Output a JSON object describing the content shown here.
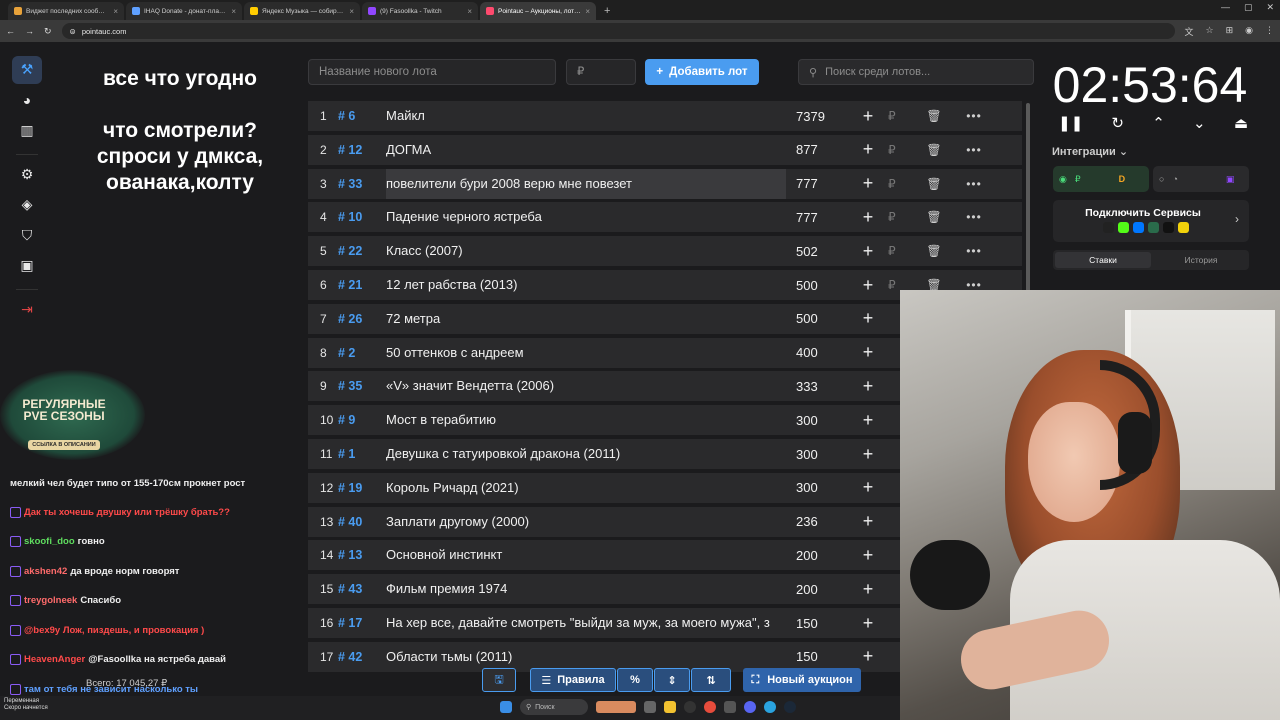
{
  "browser": {
    "tabs": [
      {
        "title": "Виджет последних сообщений",
        "color": "#e8a23a",
        "active": false
      },
      {
        "title": "IHAQ Donate - донат-платформа",
        "color": "#5fa0ff",
        "active": false
      },
      {
        "title": "Яндекс Музыка — собираем",
        "color": "#ffcc00",
        "active": false
      },
      {
        "title": "(9) Fasoollka - Twitch",
        "color": "#9147ff",
        "active": false
      },
      {
        "title": "Pointauc – Аукционы, лотереи",
        "color": "#ff4a6e",
        "active": true
      }
    ],
    "url": "pointauc.com"
  },
  "overlay": {
    "line1": "все что угодно",
    "line2": "что смотрели?",
    "line3": "спроси у дмкса,",
    "line4": "ованака,колту",
    "badge_line1": "РЕГУЛЯРНЫЕ",
    "badge_line2": "PVE СЕЗОНЫ",
    "badge_line3": "ССЫЛКА В ОПИСАНИИ"
  },
  "chat": [
    {
      "name": "",
      "message": "мелкий чел будет типо от 155-170см прокнет рост",
      "color": "#efefef"
    },
    {
      "name": "",
      "message": "Дак ты хочешь двушку или трёшку брать??",
      "color": "#ff4a4a"
    },
    {
      "name": "skoofi_doo",
      "message": "говно",
      "color": "#5fdd5f"
    },
    {
      "name": "akshen42",
      "message": "да вроде норм говорят",
      "color": "#ff6b6b"
    },
    {
      "name": "treygolneek",
      "message": "Спасибо",
      "color": "#ff6b6b"
    },
    {
      "name": "",
      "message": "@bex9y Лож, пиздешь, и провокация )",
      "color": "#ff4a4a"
    },
    {
      "name": "HeavenAnger",
      "message": "@Fasoollka на ястреба давай",
      "color": "#ff4a4a"
    },
    {
      "name": "",
      "message": "там от тебя не зависит насколько ты",
      "color": "#5fa0ff"
    }
  ],
  "form": {
    "lot_placeholder": "Название нового лота",
    "price_placeholder": "₽",
    "add_label": "Добавить лот",
    "search_placeholder": "Поиск среди лотов..."
  },
  "lots": [
    {
      "n": "1",
      "id": "# 6",
      "name": "Майкл",
      "amount": "7379"
    },
    {
      "n": "2",
      "id": "# 12",
      "name": "ДОГМА",
      "amount": "877"
    },
    {
      "n": "3",
      "id": "# 33",
      "name": "повелители бури 2008 верю мне повезет",
      "amount": "777"
    },
    {
      "n": "4",
      "id": "# 10",
      "name": "Падение черного ястреба",
      "amount": "777"
    },
    {
      "n": "5",
      "id": "# 22",
      "name": "Класс (2007)",
      "amount": "502"
    },
    {
      "n": "6",
      "id": "# 21",
      "name": "12 лет рабства (2013)",
      "amount": "500"
    },
    {
      "n": "7",
      "id": "# 26",
      "name": "72 метра",
      "amount": "500"
    },
    {
      "n": "8",
      "id": "# 2",
      "name": "50 оттенков с андреем",
      "amount": "400"
    },
    {
      "n": "9",
      "id": "# 35",
      "name": "«V» значит Вендетта (2006)",
      "amount": "333"
    },
    {
      "n": "10",
      "id": "# 9",
      "name": "Мост в терабитию",
      "amount": "300"
    },
    {
      "n": "11",
      "id": "# 1",
      "name": "Девушка с татуировкой дракона (2011)",
      "amount": "300"
    },
    {
      "n": "12",
      "id": "# 19",
      "name": "Король Ричард (2021)",
      "amount": "300"
    },
    {
      "n": "13",
      "id": "# 40",
      "name": "Заплати другому (2000)",
      "amount": "236"
    },
    {
      "n": "14",
      "id": "# 13",
      "name": "Основной инстинкт",
      "amount": "200"
    },
    {
      "n": "15",
      "id": "# 43",
      "name": "Фильм премия 1974",
      "amount": "200"
    },
    {
      "n": "16",
      "id": "# 17",
      "name": "На хер все, давайте смотреть \"выйди за муж, за моего мужа\", з",
      "amount": "150"
    },
    {
      "n": "17",
      "id": "# 42",
      "name": "Области тьмы (2011)",
      "amount": "150"
    }
  ],
  "timer": "02:53:64",
  "integrations": {
    "label": "Интеграции",
    "connect_label": "Подключить Сервисы",
    "tab_bets": "Ставки",
    "tab_history": "История"
  },
  "toolbar": {
    "rules": "Правила",
    "percent": "%",
    "new_auction": "Новый аукцион",
    "total": "Всего: 17 045,27 ₽"
  },
  "taskbar": {
    "search": "Поиск",
    "left_line1": "Переменная",
    "left_line2": "Скоро начнется"
  }
}
